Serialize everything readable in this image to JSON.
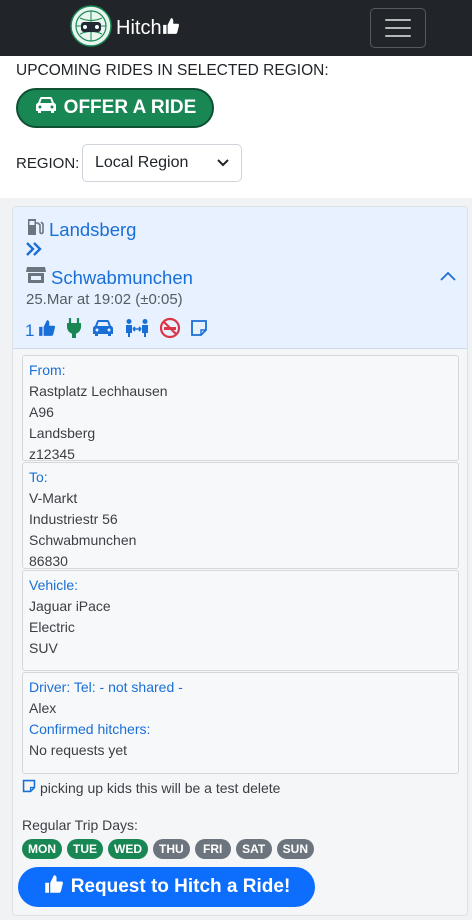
{
  "navbar": {
    "brand": "Hitch",
    "menu_icon": "hamburger-menu-icon"
  },
  "top": {
    "heading": "UPCOMING RIDES IN SELECTED REGION:",
    "offer_button": "OFFER A RIDE",
    "region_label": "REGION:",
    "region_value": "Local Region"
  },
  "ride": {
    "from_place": "Landsberg",
    "to_place": "Schwabmunchen",
    "time": "25.Mar at 19:02 (±0:05)",
    "seats": "1",
    "icons": [
      "thumbs-up-icon",
      "plug-icon",
      "car-icon",
      "people-arrows-icon",
      "no-smoking-icon",
      "note-icon"
    ],
    "from": {
      "label": "From:",
      "lines": [
        "Rastplatz Lechhausen",
        "A96",
        "Landsberg",
        "z12345"
      ]
    },
    "to": {
      "label": "To:",
      "lines": [
        "V-Markt",
        "Industriestr 56",
        "Schwabmunchen",
        "86830"
      ]
    },
    "vehicle": {
      "label": "Vehicle:",
      "lines": [
        "Jaguar iPace",
        "Electric",
        "SUV"
      ]
    },
    "driver": {
      "label": "Driver: Tel: - not shared -",
      "name": "Alex",
      "hitchers_label": "Confirmed hitchers:",
      "hitchers_value": "No requests yet"
    },
    "note": "picking up kids this will be a test delete",
    "days_label": "Regular Trip Days:",
    "days": [
      {
        "label": "MON",
        "active": true
      },
      {
        "label": "TUE",
        "active": true
      },
      {
        "label": "WED",
        "active": true
      },
      {
        "label": "THU",
        "active": false
      },
      {
        "label": "FRI",
        "active": false
      },
      {
        "label": "SAT",
        "active": false
      },
      {
        "label": "SUN",
        "active": false
      }
    ],
    "request_button": "Request to Hitch a Ride!"
  },
  "colors": {
    "navbar": "#212529",
    "success": "#198754",
    "primary": "#0d6efd",
    "link": "#1a6fd6",
    "header_bg": "#e7f1ff",
    "danger": "#dc3545"
  }
}
